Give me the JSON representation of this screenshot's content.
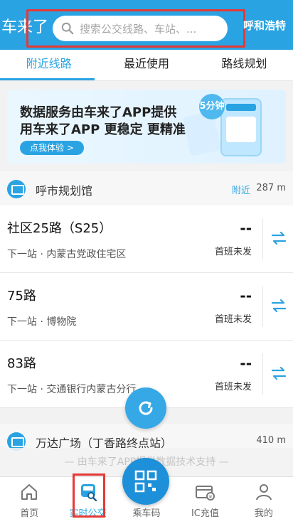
{
  "header": {
    "app_title": "车来了",
    "search_placeholder": "搜索公交线路、车站、...",
    "city": "呼和浩特"
  },
  "tabs": [
    {
      "label": "附近线路",
      "active": true
    },
    {
      "label": "最近使用",
      "active": false
    },
    {
      "label": "路线规划",
      "active": false
    }
  ],
  "banner": {
    "line1": "数据服务由车来了APP提供",
    "line2": "用车来了APP  更稳定 更精准",
    "button": "点我体验 >",
    "badge": "5分钟"
  },
  "stops": [
    {
      "name": "呼市规划馆",
      "near_label": "附近",
      "distance": "287 m",
      "routes": [
        {
          "name": "社区25路（S25）",
          "next": "下一站 · 内蒙古党政住宅区",
          "eta": "--",
          "status": "首班未发"
        },
        {
          "name": "75路",
          "next": "下一站 · 博物院",
          "eta": "--",
          "status": "首班未发"
        },
        {
          "name": "83路",
          "next": "下一站 · 交通银行内蒙古分行",
          "eta": "--",
          "status": "首班未发"
        }
      ]
    },
    {
      "name": "万达广场（丁香路终点站）",
      "distance": "410 m"
    }
  ],
  "footnote": "— 由车来了APP提供数据技术支持 —",
  "nav": [
    {
      "label": "首页",
      "icon": "home-icon",
      "active": false
    },
    {
      "label": "实时公交",
      "icon": "bus-search-icon",
      "active": true
    },
    {
      "label": "乘车码",
      "icon": "qr-code-icon",
      "active": false
    },
    {
      "label": "IC充值",
      "icon": "card-recharge-icon",
      "active": false
    },
    {
      "label": "我的",
      "icon": "profile-icon",
      "active": false
    }
  ],
  "colors": {
    "accent": "#2aa3e2",
    "highlight": "#e53935"
  }
}
